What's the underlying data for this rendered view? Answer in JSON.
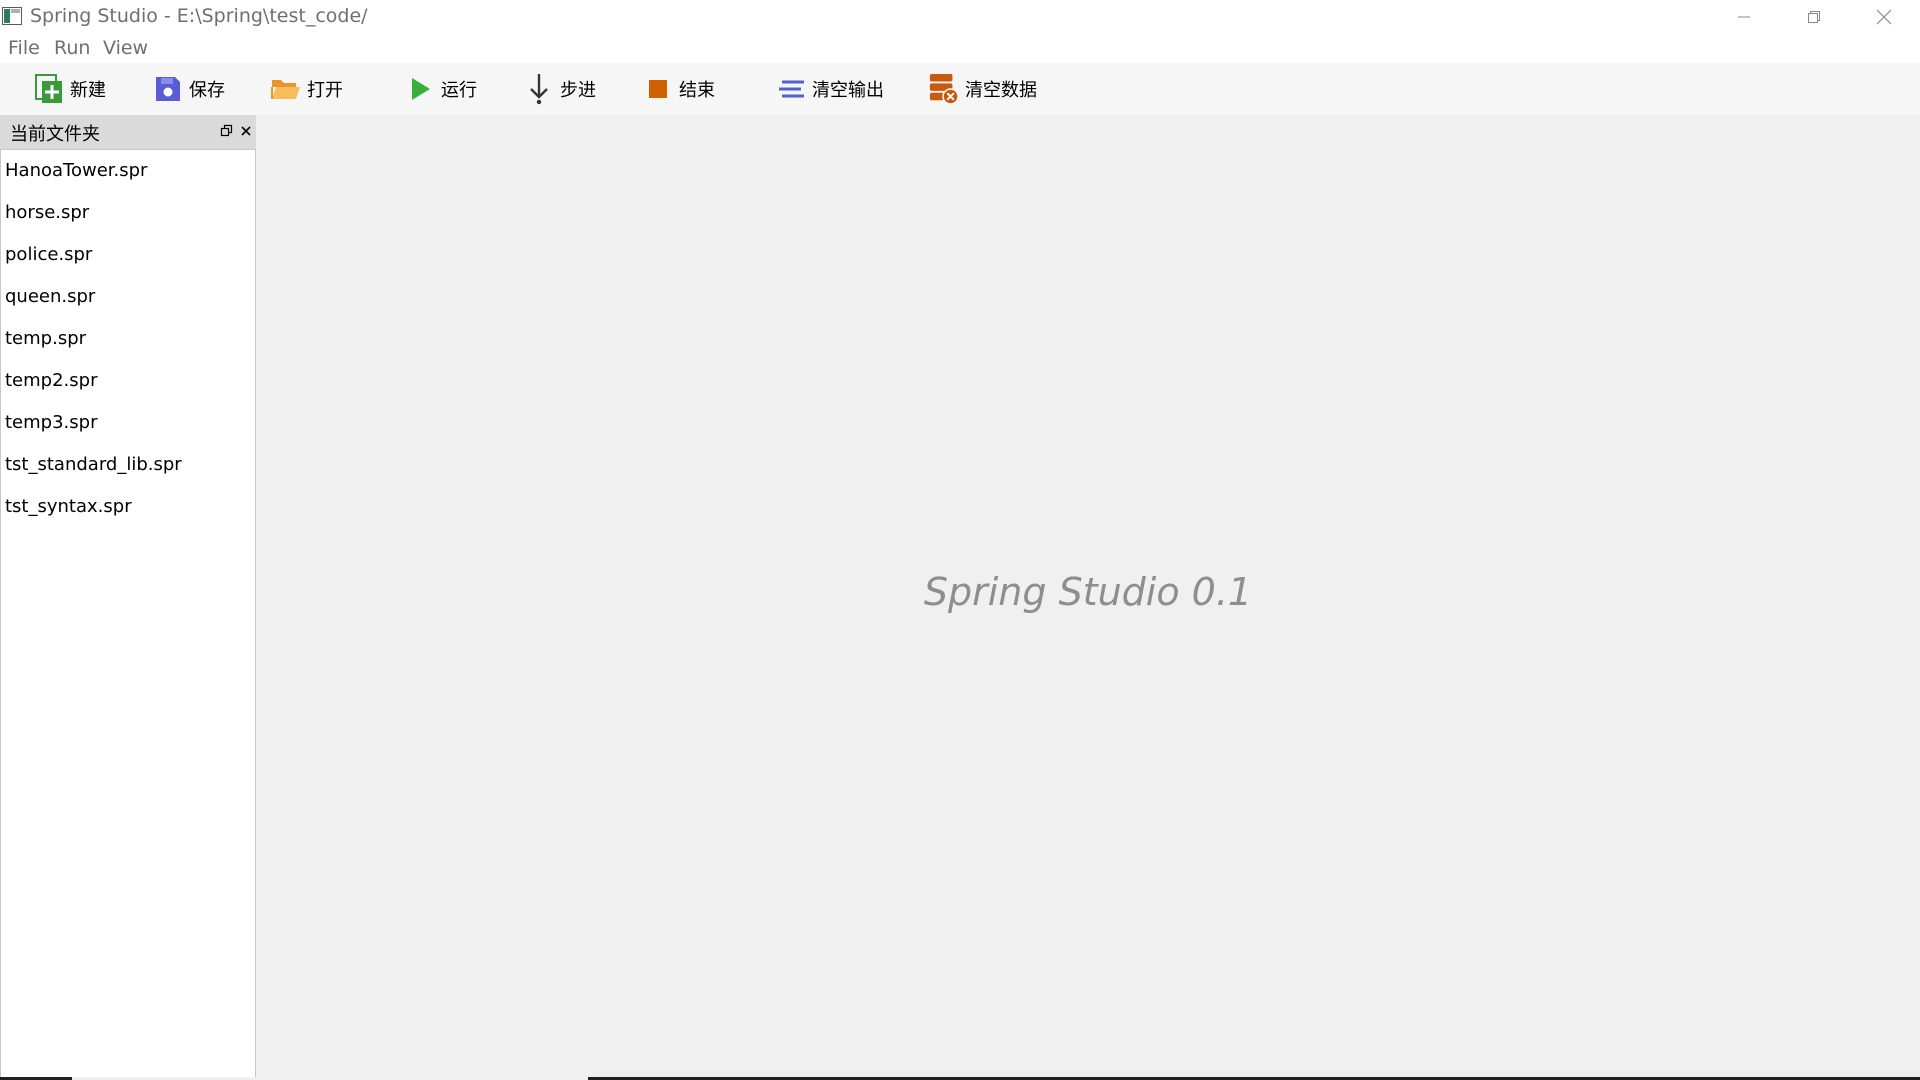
{
  "window": {
    "title": "Spring Studio - E:\\Spring\\test_code/"
  },
  "menu": {
    "file": "File",
    "run": "Run",
    "view": "View"
  },
  "toolbar": {
    "new_label": "新建",
    "save_label": "保存",
    "open_label": "打开",
    "run_label": "运行",
    "step_label": "步进",
    "stop_label": "结束",
    "clear_output_label": "清空输出",
    "clear_data_label": "清空数据"
  },
  "dock": {
    "title": "当前文件夹",
    "files": [
      "HanoaTower.spr",
      "horse.spr",
      "police.spr",
      "queen.spr",
      "temp.spr",
      "temp2.spr",
      "temp3.spr",
      "tst_standard_lib.spr",
      "tst_syntax.spr"
    ]
  },
  "main": {
    "splash_text": "Spring Studio 0.1"
  },
  "colors": {
    "accent_green": "#3a9a3a",
    "save_blue": "#5b5bd6",
    "folder_orange": "#f2a93b",
    "run_green": "#3cae3c",
    "stop_orange": "#d06000",
    "clear_output_blue": "#5060d8",
    "clear_data_orange": "#c85a10"
  },
  "icons": {
    "app": "app-icon",
    "new": "new-file-plus-icon",
    "save": "floppy-save-icon",
    "open": "open-folder-icon",
    "run": "play-icon",
    "step": "step-down-arrow-icon",
    "stop": "stop-square-icon",
    "clear_output": "clear-lines-icon",
    "clear_data": "database-clear-icon"
  }
}
